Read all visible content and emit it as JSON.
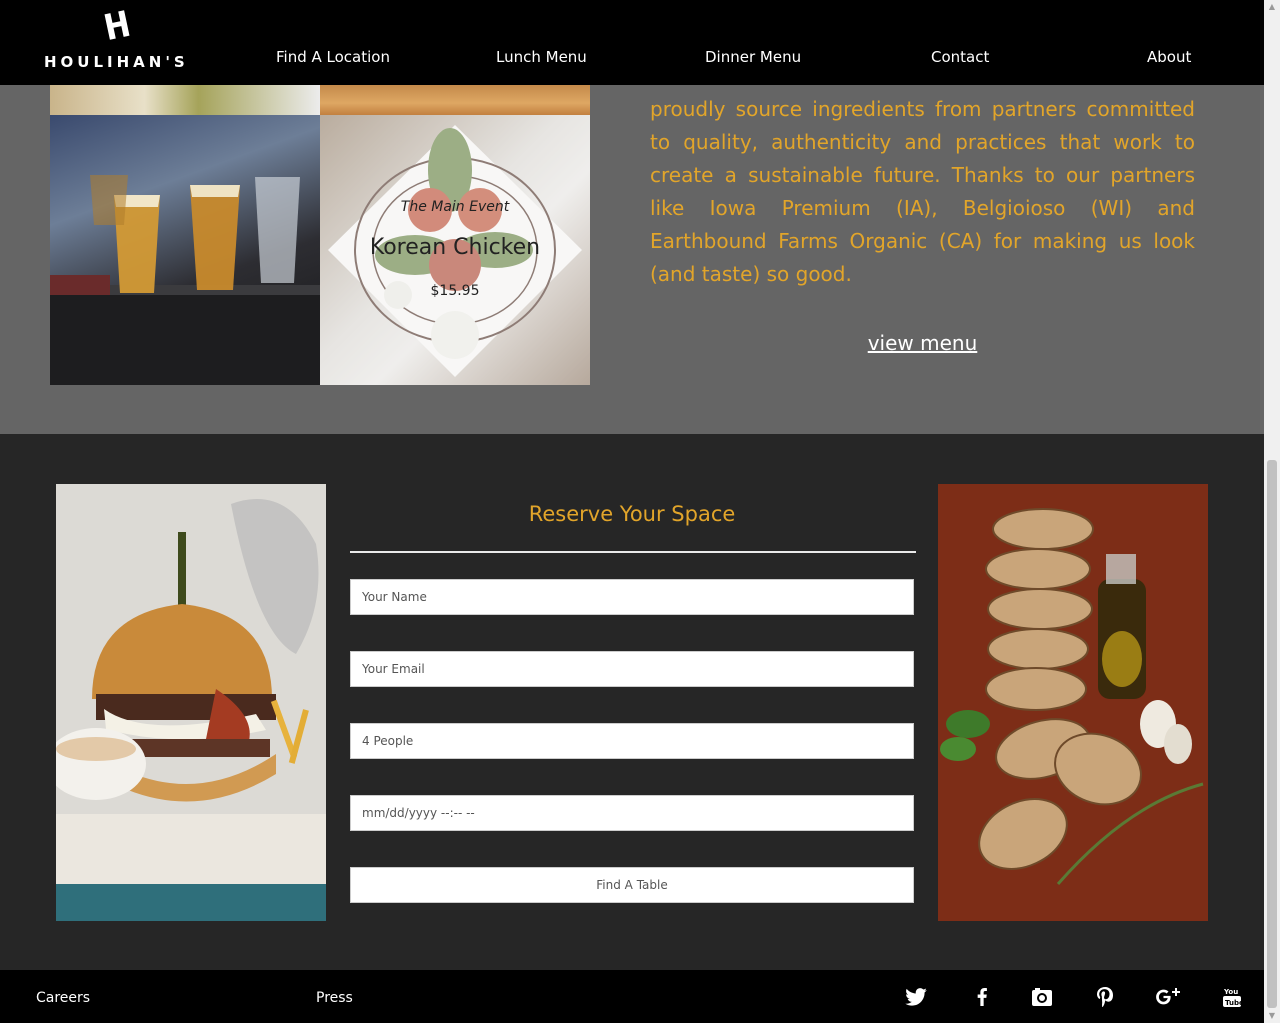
{
  "brand": {
    "name": "HOULIHAN'S",
    "mark_letter": "H"
  },
  "nav": {
    "items": [
      "Find A Location",
      "Lunch Menu",
      "Dinner Menu",
      "Contact",
      "About"
    ]
  },
  "featured": {
    "kicker": "The Main Event",
    "dish_name": "Korean Chicken",
    "price": "$15.95"
  },
  "intro": {
    "text": "proudly source ingredients from partners committed to quality, authenticity and practices that work to create a sustainable future. Thanks to our partners like Iowa Premium (IA), Belgioioso (WI) and Earthbound Farms Organic (CA) for making us look (and taste) so good.",
    "view_menu_label": "view menu"
  },
  "reserve": {
    "title": "Reserve Your Space",
    "name_placeholder": "Your Name",
    "email_placeholder": "Your Email",
    "party_value": "4 People",
    "datetime_placeholder": "mm/dd/yyyy --:-- --",
    "submit_label": "Find A Table"
  },
  "footer": {
    "links": [
      "Careers",
      "Press"
    ],
    "social": [
      "twitter-icon",
      "facebook-icon",
      "instagram-icon",
      "pinterest-icon",
      "google-plus-icon",
      "youtube-icon"
    ]
  },
  "colors": {
    "accent": "#e2a52a",
    "nav_bg": "#000000",
    "upper_bg": "#656565",
    "lower_bg": "#262626"
  }
}
